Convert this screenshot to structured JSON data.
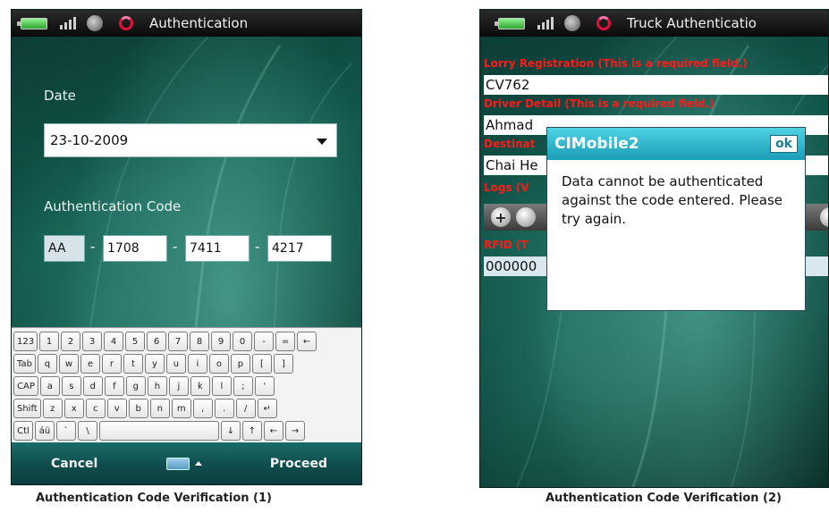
{
  "screen1": {
    "status_title": "Authentication",
    "date_label": "Date",
    "date_value": "23-10-2009",
    "auth_label": "Authentication Code",
    "code_prefix": "AA",
    "code_parts": [
      "1708",
      "7411",
      "4217"
    ],
    "separator": "-",
    "keyboard": {
      "row1": [
        "123",
        "1",
        "2",
        "3",
        "4",
        "5",
        "6",
        "7",
        "8",
        "9",
        "0",
        "-",
        "=",
        "←"
      ],
      "row2": [
        "Tab",
        "q",
        "w",
        "e",
        "r",
        "t",
        "y",
        "u",
        "i",
        "o",
        "p",
        "[",
        "]"
      ],
      "row3": [
        "CAP",
        "a",
        "s",
        "d",
        "f",
        "g",
        "h",
        "j",
        "k",
        "l",
        ";",
        "'"
      ],
      "row4": [
        "Shift",
        "z",
        "x",
        "c",
        "v",
        "b",
        "n",
        "m",
        ",",
        ".",
        "/",
        "↵"
      ],
      "row5": [
        "Ctl",
        "áü",
        "`",
        "\\",
        "",
        "↓",
        "↑",
        "←",
        "→"
      ]
    },
    "soft_left": "Cancel",
    "soft_right": "Proceed"
  },
  "screen2": {
    "status_title": "Truck Authenticatio",
    "lorry_label": "Lorry Registration (This is a required field.)",
    "lorry_value": "CV762",
    "driver_label": "Driver Detail (This is a required field.)",
    "driver_value": "Ahmad",
    "destination_label": "Destinat",
    "destination_value": "Chai He",
    "logs_label": "Logs (V",
    "rfid_label": "RFID (T",
    "rfid_value": "000000",
    "dialog": {
      "title": "CIMobile2",
      "ok": "ok",
      "message": "Data cannot be authenticated against the code entered. Please try again."
    }
  },
  "captions": {
    "left": "Authentication Code Verification (1)",
    "right": "Authentication Code Verification (2)"
  }
}
